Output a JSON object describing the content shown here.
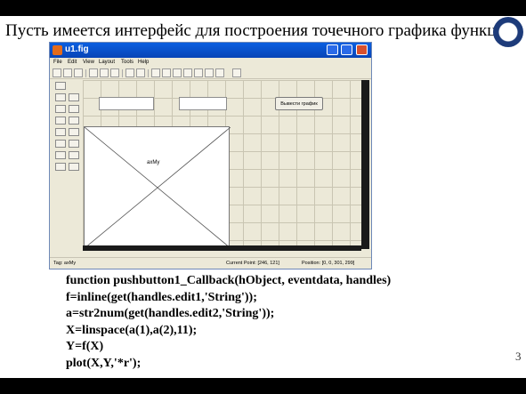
{
  "slide": {
    "title": "Пусть имеется интерфейс для построения точечного графика функции",
    "page_number": "3"
  },
  "window": {
    "title": "u1.fig",
    "menu": [
      "File",
      "Edit",
      "View",
      "Layout",
      "Tools",
      "Help"
    ],
    "button_label": "Вывести график",
    "axes_tag": "axMy",
    "status": {
      "tag": "Tag: axMy",
      "current_point": "Current Point:  [246, 121]",
      "position": "Position: [0, 0, 301, 299]"
    }
  },
  "code": {
    "lines": [
      "function pushbutton1_Callback(hObject, eventdata, handles)",
      "f=inline(get(handles.edit1,'String'));",
      "a=str2num(get(handles.edit2,'String'));",
      "X=linspace(a(1),a(2),11);",
      "Y=f(X)",
      "plot(X,Y,'*r');"
    ]
  },
  "colors": {
    "titlebar": "#0a5fe0",
    "window_bg": "#ece9d8",
    "grid": "#c9c5b2"
  }
}
